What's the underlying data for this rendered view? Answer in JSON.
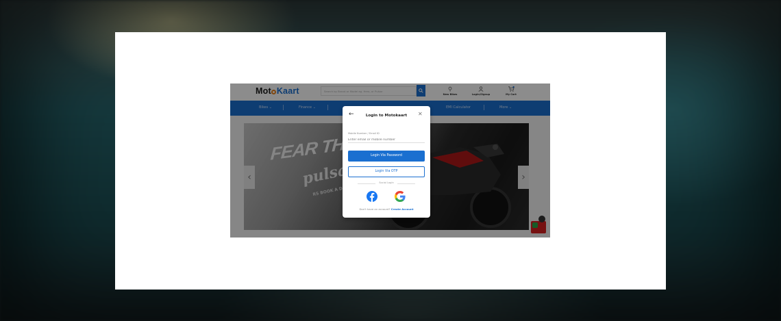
{
  "site": {
    "logo_prefix": "Mot",
    "logo_suffix": "Kaart",
    "search_placeholder": "Search by Brand or Model eg. Hero, or Pulsar",
    "header_links": [
      {
        "label": "New Bikes",
        "icon": "bike-icon"
      },
      {
        "label": "Login/Signup",
        "icon": "user-icon"
      },
      {
        "label": "My Cart",
        "icon": "cart-icon"
      }
    ],
    "nav": [
      "Bikes",
      "Finance",
      "EMI Calculator",
      "More"
    ],
    "banner": {
      "headline": "FEAR THE L",
      "brand": "pulsa",
      "model": "RS",
      "tagline": "BOOK A DEMO"
    },
    "accent_color": "#1a6fd0",
    "logo_ring_color": "#e9821d"
  },
  "modal": {
    "back_icon": "arrow-left-icon",
    "title": "Login to Motokaart",
    "close_icon": "close-icon",
    "field_label": "Mobile Number / Email ID",
    "field_placeholder": "Enter email or mobile number",
    "primary_button": "Login Via Password",
    "secondary_button": "Login Via OTP",
    "divider_text": "Social Login",
    "social": [
      "facebook-icon",
      "google-icon"
    ],
    "footer_prompt": "Don't have an account?",
    "footer_link": "Create Account"
  }
}
